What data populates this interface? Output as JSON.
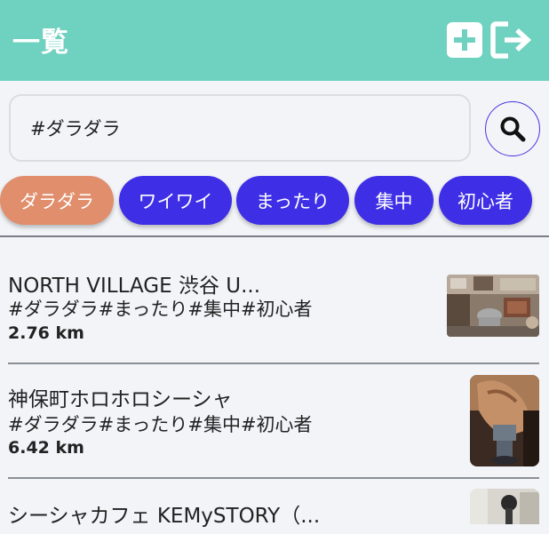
{
  "header": {
    "title": "一覧",
    "add_icon": "plus-square-icon",
    "logout_icon": "logout-icon",
    "accent_color": "#6fd1c0"
  },
  "search": {
    "value": "#ダラダラ",
    "button_icon": "search-icon"
  },
  "tags": [
    {
      "label": "ダラダラ",
      "active": true
    },
    {
      "label": "ワイワイ",
      "active": false
    },
    {
      "label": "まったり",
      "active": false
    },
    {
      "label": "集中",
      "active": false
    },
    {
      "label": "初心者",
      "active": false
    }
  ],
  "tag_colors": {
    "active": "#e08e6b",
    "inactive": "#3e2fe6"
  },
  "items": [
    {
      "name": "NORTH VILLAGE 渋谷 U...",
      "tags": "#ダラダラ#まったり#集中#初心者",
      "distance": "2.76 km"
    },
    {
      "name": "神保町ホロホロシーシャ",
      "tags": "#ダラダラ#まったり#集中#初心者",
      "distance": "6.42 km"
    },
    {
      "name": "シーシャカフェ KEMySTORY（...",
      "tags": "",
      "distance": ""
    }
  ]
}
